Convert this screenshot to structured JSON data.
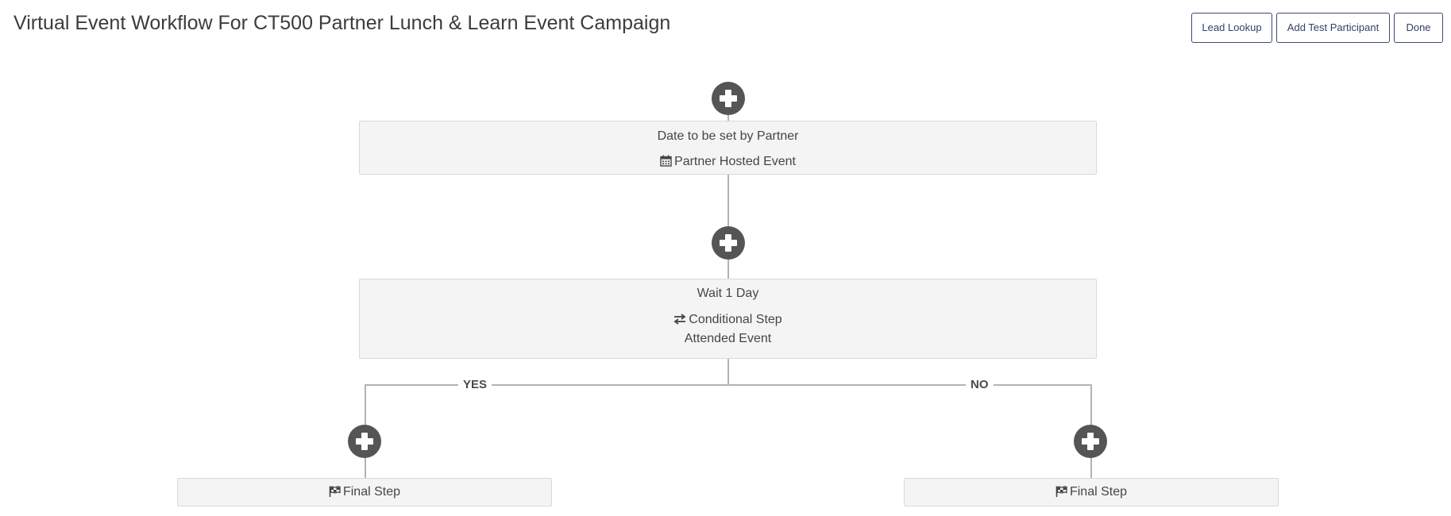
{
  "header": {
    "title": "Virtual Event Workflow For CT500 Partner Lunch & Learn Event Campaign"
  },
  "toolbar": {
    "lead_lookup_label": "Lead Lookup",
    "add_test_participant_label": "Add Test Participant",
    "done_label": "Done"
  },
  "workflow": {
    "step1": {
      "title": "Date to be set by Partner",
      "type_icon": "calendar-icon",
      "type_label": "Partner Hosted Event"
    },
    "step2": {
      "title": "Wait 1 Day",
      "type_icon": "exchange-arrows-icon",
      "type_label": "Conditional Step",
      "condition": "Attended Event"
    },
    "branches": {
      "yes_label": "YES",
      "no_label": "NO"
    },
    "yes_final": {
      "type_icon": "flag-checkered-icon",
      "label": "Final Step"
    },
    "no_final": {
      "type_icon": "flag-checkered-icon",
      "label": "Final Step"
    }
  },
  "colors": {
    "button_border": "#3b4a78",
    "add_button": "#555555",
    "connector": "#b3b3b3",
    "card_background": "#f4f4f4"
  }
}
